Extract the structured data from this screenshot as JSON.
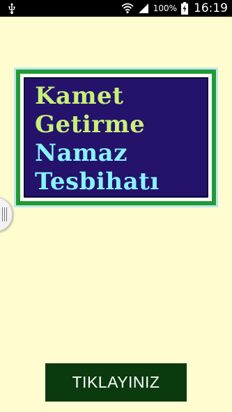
{
  "status_bar": {
    "battery_percent": "100%",
    "time": "16:19",
    "icons": [
      "usb-icon",
      "wifi-icon",
      "signal-icon",
      "battery-charging-icon"
    ]
  },
  "banner": {
    "lines": [
      "Kamet",
      "Getirme",
      "Namaz",
      "Tesbihatı"
    ],
    "colors": {
      "outer": "#bfe5ec",
      "border": "#1f9a35",
      "background": "#24126b",
      "text_green": "#c8f078",
      "text_cyan": "#86f4ff"
    }
  },
  "drawer": {
    "icon": "drawer-handle-icon"
  },
  "action": {
    "button_label": "TIKLAYINIZ",
    "color": "#0b3a0f"
  },
  "theme": {
    "background": "#fffdd0"
  }
}
